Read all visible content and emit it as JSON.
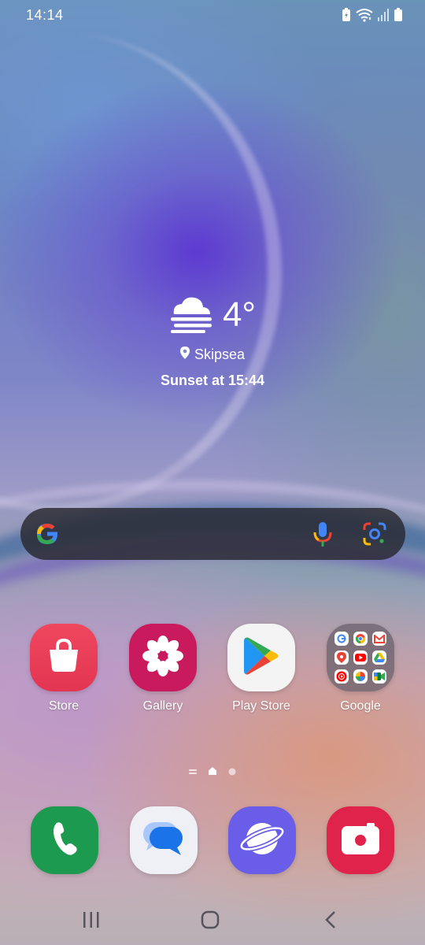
{
  "status_bar": {
    "time": "14:14",
    "icons": [
      "battery-saver-icon",
      "wifi-icon",
      "signal-icon",
      "battery-icon"
    ]
  },
  "weather": {
    "icon": "fog-cloud-icon",
    "temperature": "4°",
    "location_icon": "location-pin-icon",
    "location": "Skipsea",
    "sunset": "Sunset at 15:44"
  },
  "search_bar": {
    "icons": [
      "google-g-icon",
      "microphone-icon",
      "google-lens-icon"
    ]
  },
  "apps": [
    {
      "label": "Store",
      "icon": "shopping-bag-icon"
    },
    {
      "label": "Gallery",
      "icon": "flower-icon"
    },
    {
      "label": "Play Store",
      "icon": "play-triangle-icon"
    },
    {
      "label": "Google",
      "icon": "folder-icon"
    }
  ],
  "google_folder_apps": [
    "google-icon",
    "chrome-icon",
    "gmail-icon",
    "maps-icon",
    "youtube-icon",
    "drive-icon",
    "youtube-music-icon",
    "photos-icon",
    "meet-icon"
  ],
  "page_indicator": {
    "pages": 3,
    "current": 2
  },
  "dock": [
    {
      "name": "phone",
      "icon": "phone-handset-icon"
    },
    {
      "name": "messages",
      "icon": "chat-bubble-icon"
    },
    {
      "name": "internet",
      "icon": "planet-icon"
    },
    {
      "name": "camera",
      "icon": "camera-icon"
    }
  ],
  "nav_bar": {
    "buttons": [
      "recents-icon",
      "home-icon",
      "back-icon"
    ]
  },
  "colors": {
    "store": "#e8394f",
    "gallery": "#c91a5e",
    "phone": "#1c9a50",
    "internet": "#6a5ee8",
    "camera": "#e0234a"
  }
}
